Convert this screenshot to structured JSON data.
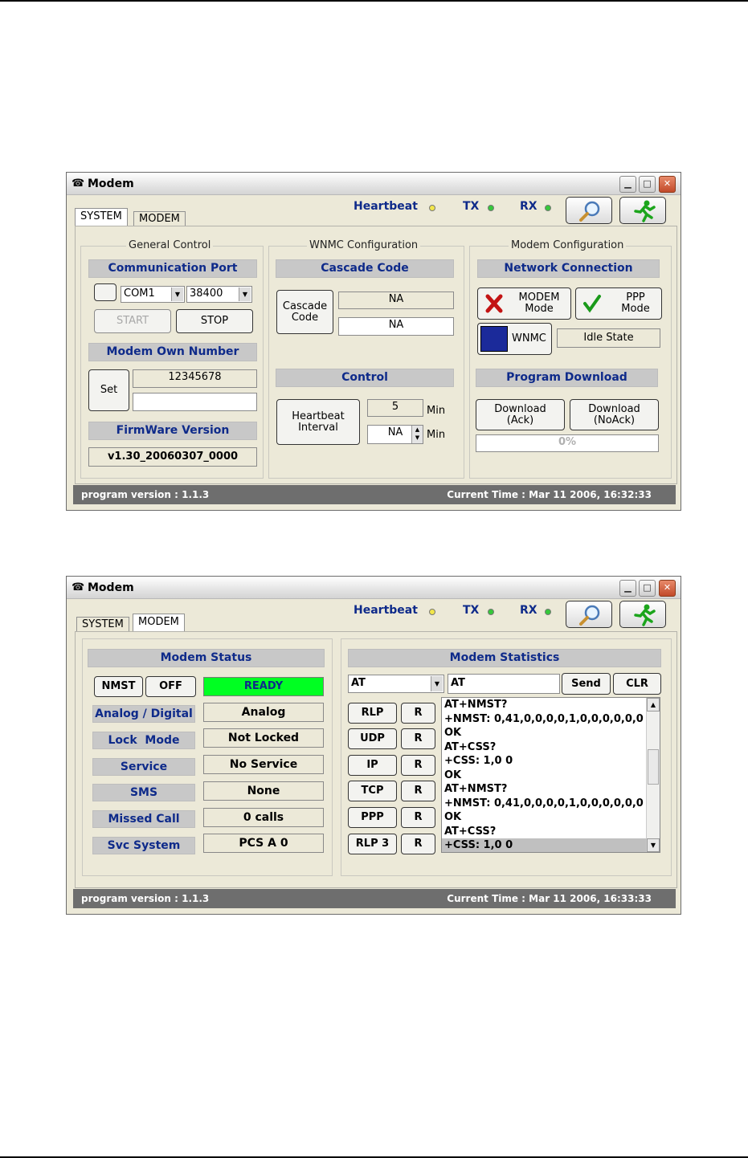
{
  "title": "Modem",
  "indicators": {
    "heartbeat": "Heartbeat",
    "tx": "TX",
    "rx": "RX"
  },
  "tabs": {
    "system": "SYSTEM",
    "modem": "MODEM"
  },
  "system": {
    "general": {
      "title": "General Control",
      "comm_port": "Communication Port",
      "port": "COM1",
      "baud": "38400",
      "start": "START",
      "stop": "STOP",
      "own_number_label": "Modem Own Number",
      "set": "Set",
      "own_number": "12345678",
      "own_number_new": "",
      "firmware_label": "FirmWare Version",
      "firmware": "v1.30_20060307_0000"
    },
    "wnmc": {
      "title": "WNMC Configuration",
      "cascade_label": "Cascade Code",
      "cascade_btn": "Cascade Code",
      "cascade_value1": "NA",
      "cascade_value2": "NA",
      "control_label": "Control",
      "heartbeat_btn": "Heartbeat Interval",
      "interval1": "5",
      "interval2": "NA",
      "min": "Min"
    },
    "modem_config": {
      "title": "Modem Configuration",
      "network_label": "Network Connection",
      "modem_mode": "MODEM Mode",
      "ppp_mode": "PPP Mode",
      "wnmc": "WNMC",
      "idle_state": "Idle State",
      "program_download": "Program Download",
      "download_ack": "Download (Ack)",
      "download_noack": "Download (NoAck)",
      "progress": "0%",
      "progress_value": 0
    }
  },
  "modem": {
    "status_title": "Modem Status",
    "nmst": "NMST",
    "off": "OFF",
    "ready": "READY",
    "rows": [
      {
        "label": "Analog / Digital",
        "value": "Analog"
      },
      {
        "label": "Lock  Mode",
        "value": "Not Locked"
      },
      {
        "label": "Service",
        "value": "No Service"
      },
      {
        "label": "SMS",
        "value": "None"
      },
      {
        "label": "Missed Call",
        "value": "0 calls"
      },
      {
        "label": "Svc System",
        "value": "PCS A 0"
      }
    ],
    "stats_title": "Modem Statistics",
    "cmd_select": "AT",
    "cmd_input": "AT",
    "send": "Send",
    "clr": "CLR",
    "protocols": [
      "RLP",
      "UDP",
      "IP",
      "TCP",
      "PPP",
      "RLP 3"
    ],
    "reset": "R",
    "log": [
      "AT+NMST?",
      "+NMST: 0,41,0,0,0,0,1,0,0,0,0,0,0",
      "OK",
      "AT+CSS?",
      "+CSS: 1,0 0",
      "OK",
      "AT+NMST?",
      "+NMST: 0,41,0,0,0,0,1,0,0,0,0,0,0",
      "OK",
      "AT+CSS?",
      "+CSS: 1,0 0"
    ]
  },
  "status_bar": {
    "program_version_1": "program version : 1.1.3",
    "current_time_1": "Current Time : Mar 11 2006, 16:32:33",
    "program_version_2": "program version : 1.1.3",
    "current_time_2": "Current Time : Mar 11 2006, 16:33:33"
  },
  "colors": {
    "accent": "#0e2a8a",
    "ready": "#00ff22",
    "led_yellow": "#f2e64a",
    "led_green": "#35c83a"
  }
}
